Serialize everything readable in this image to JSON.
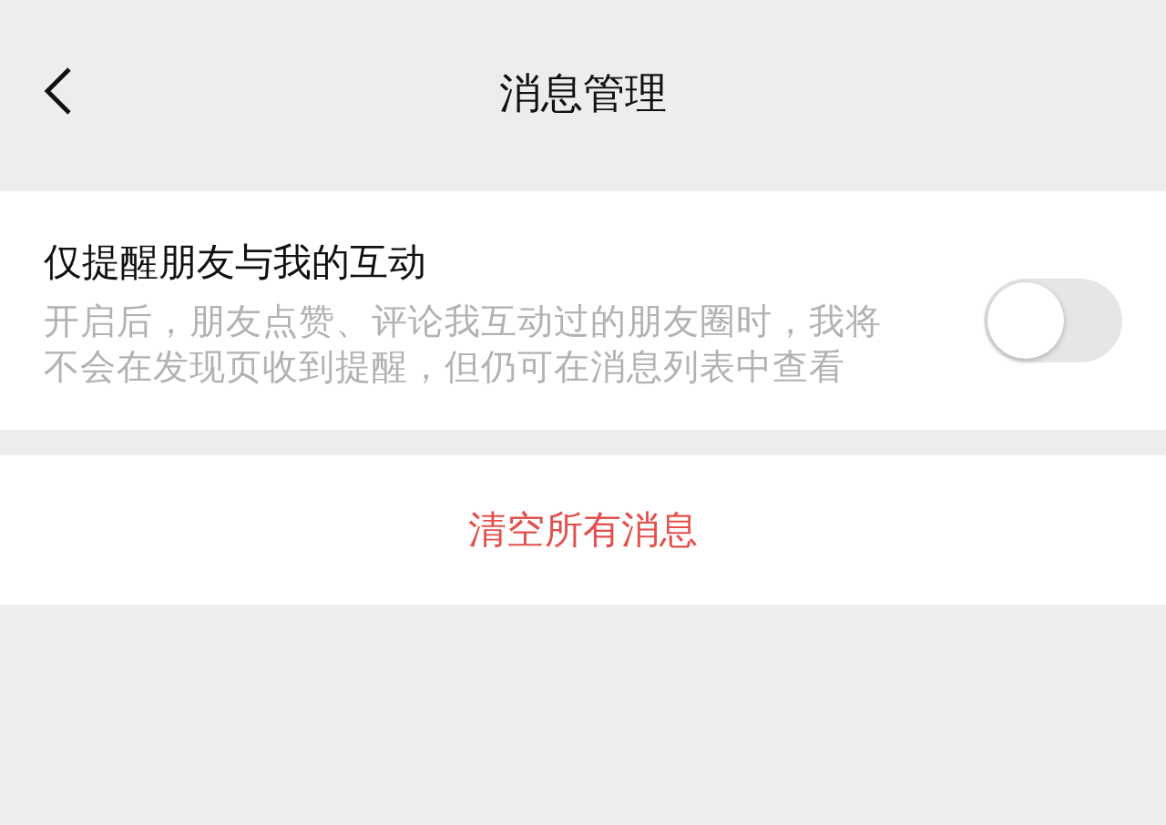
{
  "window": {
    "title": "消息管理"
  },
  "setting": {
    "title": "仅提醒朋友与我的互动",
    "description": "开启后，朋友点赞、评论我互动过的朋友圈时，我将不会在发现页收到提醒，但仍可在消息列表中查看",
    "on": false
  },
  "action": {
    "label": "清空所有消息"
  }
}
